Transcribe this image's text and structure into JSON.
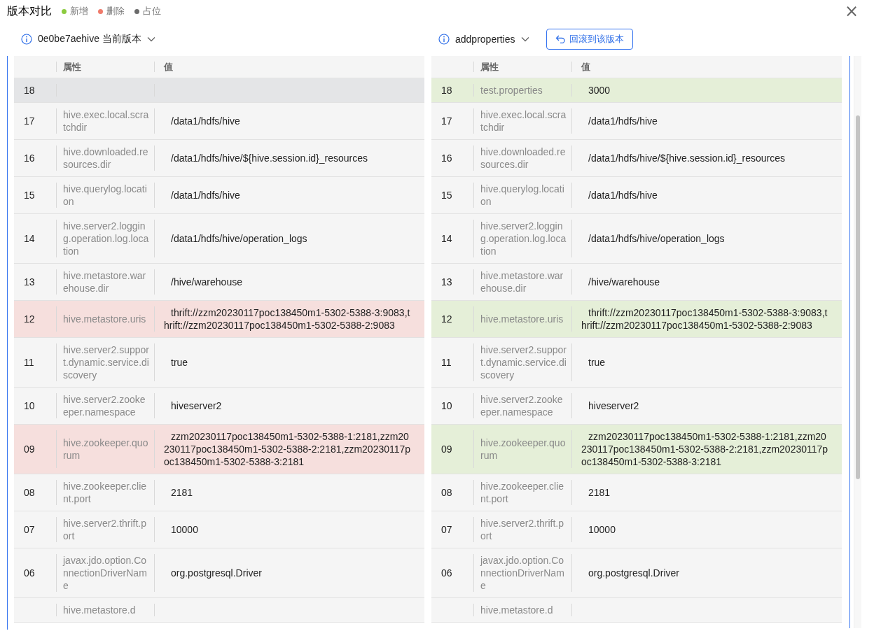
{
  "title": "版本对比",
  "legend": [
    {
      "label": "新增",
      "color": "#8ccb3f"
    },
    {
      "label": "删除",
      "color": "#f07b6b"
    },
    {
      "label": "占位",
      "color": "#6b6b6b"
    }
  ],
  "close": "×",
  "panels": [
    {
      "version": "0e0be7aehive 当前版本",
      "columns": [
        "属性",
        "值"
      ],
      "rows": [
        {
          "no": "18",
          "kind": "placeholder"
        },
        {
          "no": "17",
          "property": "hive.exec.local.scratchdir",
          "value": "/data1/hdfs/hive",
          "kind": "normal"
        },
        {
          "no": "16",
          "property": "hive.downloaded.resources.dir",
          "value": "/data1/hdfs/hive/${hive.session.id}_resources",
          "kind": "normal"
        },
        {
          "no": "15",
          "property": "hive.querylog.location",
          "value": "/data1/hdfs/hive",
          "kind": "normal"
        },
        {
          "no": "14",
          "property": "hive.server2.logging.operation.log.location",
          "value": "/data1/hdfs/hive/operation_logs",
          "kind": "normal"
        },
        {
          "no": "13",
          "property": "hive.metastore.warehouse.dir",
          "value": "/hive/warehouse",
          "kind": "normal"
        },
        {
          "no": "12",
          "property": "hive.metastore.uris",
          "value": "thrift://zzm20230117poc138450m1-5302-5388-3:9083,thrift://zzm20230117poc138450m1-5302-5388-2:9083",
          "kind": "deleted"
        },
        {
          "no": "11",
          "property": "hive.server2.support.dynamic.service.discovery",
          "value": "true",
          "kind": "normal"
        },
        {
          "no": "10",
          "property": "hive.server2.zookeeper.namespace",
          "value": "hiveserver2",
          "kind": "normal"
        },
        {
          "no": "09",
          "property": "hive.zookeeper.quorum",
          "value": "zzm20230117poc138450m1-5302-5388-1:2181,zzm20230117poc138450m1-5302-5388-2:2181,zzm20230117poc138450m1-5302-5388-3:2181",
          "kind": "deleted"
        },
        {
          "no": "08",
          "property": "hive.zookeeper.client.port",
          "value": "2181",
          "kind": "normal"
        },
        {
          "no": "07",
          "property": "hive.server2.thrift.port",
          "value": "10000",
          "kind": "normal"
        },
        {
          "no": "06",
          "property": "javax.jdo.option.ConnectionDriverName",
          "value": "org.postgresql.Driver",
          "kind": "normal"
        },
        {
          "property": "hive.metastore.d",
          "kind": "normal"
        }
      ]
    },
    {
      "version": "addproperties",
      "rollback": "回滚到该版本",
      "columns": [
        "属性",
        "值"
      ],
      "rows": [
        {
          "no": "18",
          "property": "test.properties",
          "value": "3000",
          "kind": "added"
        },
        {
          "no": "17",
          "property": "hive.exec.local.scratchdir",
          "value": "/data1/hdfs/hive",
          "kind": "normal"
        },
        {
          "no": "16",
          "property": "hive.downloaded.resources.dir",
          "value": "/data1/hdfs/hive/${hive.session.id}_resources",
          "kind": "normal"
        },
        {
          "no": "15",
          "property": "hive.querylog.location",
          "value": "/data1/hdfs/hive",
          "kind": "normal"
        },
        {
          "no": "14",
          "property": "hive.server2.logging.operation.log.location",
          "value": "/data1/hdfs/hive/operation_logs",
          "kind": "normal"
        },
        {
          "no": "13",
          "property": "hive.metastore.warehouse.dir",
          "value": "/hive/warehouse",
          "kind": "normal"
        },
        {
          "no": "12",
          "property": "hive.metastore.uris",
          "value": "thrift://zzm20230117poc138450m1-5302-5388-3:9083,thrift://zzm20230117poc138450m1-5302-5388-2:9083",
          "kind": "added"
        },
        {
          "no": "11",
          "property": "hive.server2.support.dynamic.service.discovery",
          "value": "true",
          "kind": "normal"
        },
        {
          "no": "10",
          "property": "hive.server2.zookeeper.namespace",
          "value": "hiveserver2",
          "kind": "normal"
        },
        {
          "no": "09",
          "property": "hive.zookeeper.quorum",
          "value": "zzm20230117poc138450m1-5302-5388-1:2181,zzm20230117poc138450m1-5302-5388-2:2181,zzm20230117poc138450m1-5302-5388-3:2181",
          "kind": "added"
        },
        {
          "no": "08",
          "property": "hive.zookeeper.client.port",
          "value": "2181",
          "kind": "normal"
        },
        {
          "no": "07",
          "property": "hive.server2.thrift.port",
          "value": "10000",
          "kind": "normal"
        },
        {
          "no": "06",
          "property": "javax.jdo.option.ConnectionDriverName",
          "value": "org.postgresql.Driver",
          "kind": "normal"
        },
        {
          "property": "hive.metastore.d",
          "kind": "normal"
        }
      ]
    }
  ]
}
